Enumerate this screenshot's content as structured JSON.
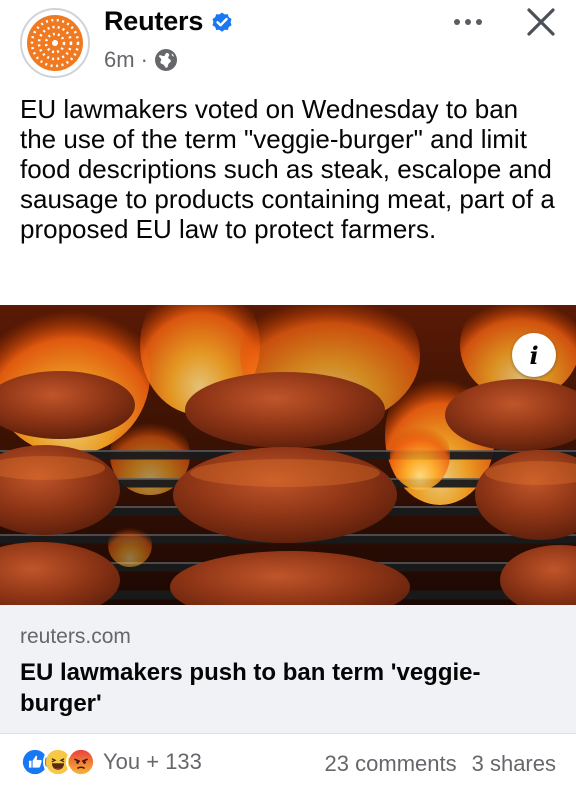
{
  "post": {
    "author": "Reuters",
    "time": "6m",
    "separator": "·",
    "privacy_icon": "globe-icon",
    "verified_icon": "verified-badge-icon",
    "text": "EU lawmakers voted on Wednesday to ban the use of the term \"veggie-burger\" and limit food descriptions such as steak, escalope and sausage to products containing meat, part of a proposed EU law to protect farmers."
  },
  "header_actions": {
    "more_icon": "more-options-icon",
    "close_icon": "close-icon"
  },
  "link": {
    "image_icon": "info-icon",
    "info_label": "i",
    "domain": "reuters.com",
    "title": "EU lawmakers push to ban term 'veggie-burger'"
  },
  "engagement": {
    "reaction_icons": [
      "like-icon",
      "haha-icon",
      "angry-icon"
    ],
    "reactors": "You + 133",
    "comments": "23 comments",
    "shares": "3 shares"
  },
  "colors": {
    "brand_orange": "#f07a22",
    "facebook_blue": "#1877f2",
    "secondary_text": "#65676b"
  }
}
